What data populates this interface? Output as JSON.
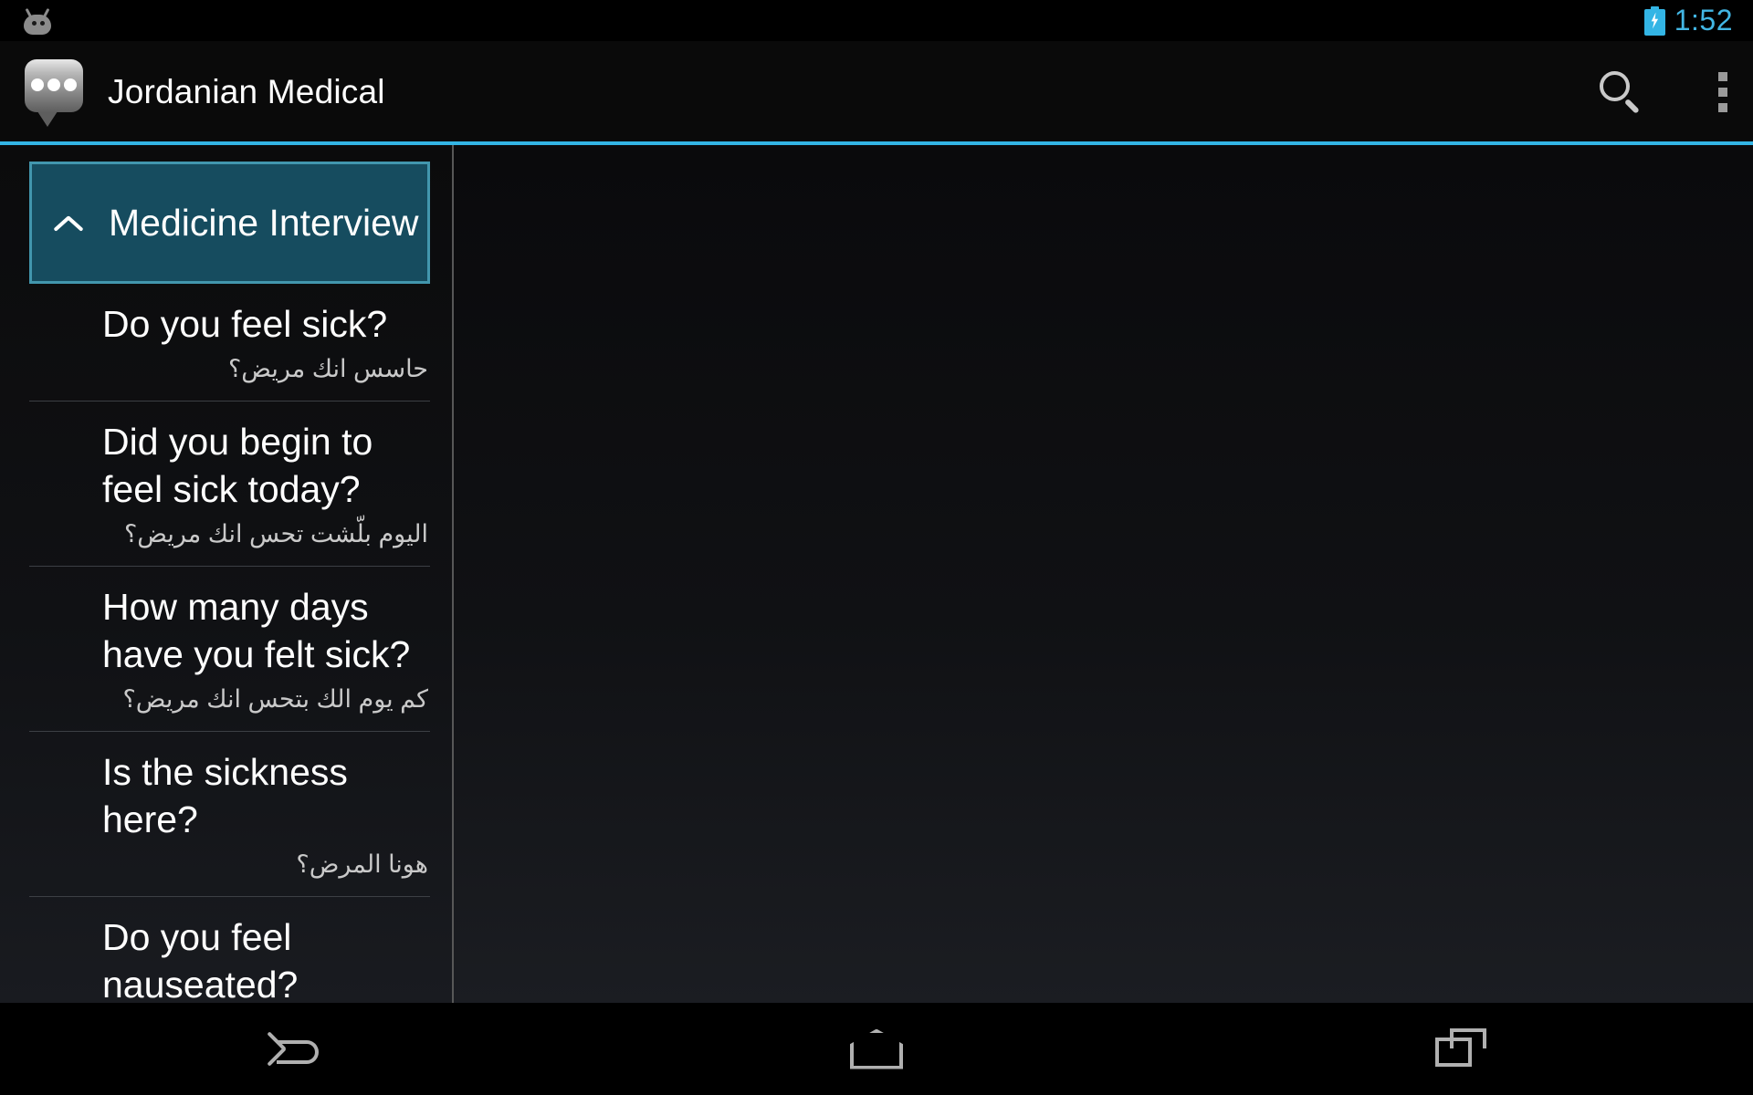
{
  "status_bar": {
    "droid_icon": "android-droid-icon",
    "battery_icon": "battery-charging-icon",
    "clock": "1:52",
    "clock_color": "#33b5e5"
  },
  "action_bar": {
    "app_icon": "speech-bubble-icon",
    "title": "Jordanian Medical",
    "search_icon": "search-icon",
    "overflow_icon": "overflow-menu-icon",
    "accent_color": "#33b5e5"
  },
  "list": {
    "group": {
      "label": "Medicine Interview",
      "expanded": true,
      "chevron_icon": "chevron-up-icon",
      "background": "#164c5f",
      "border": "#4296ad"
    },
    "phrases": [
      {
        "en": "Do you feel sick?",
        "ar": "حاسس انك مريض؟"
      },
      {
        "en": "Did you begin to feel sick today?",
        "ar": "اليوم بلّشت تحس انك مريض؟"
      },
      {
        "en": "How many days have you felt sick?",
        "ar": "كم يوم الك بتحس انك مريض؟"
      },
      {
        "en": "Is the sickness here?",
        "ar": "هونا المرض؟"
      },
      {
        "en": "Do you feel nauseated?",
        "ar": ""
      }
    ]
  },
  "nav_bar": {
    "back_icon": "back-icon",
    "home_icon": "home-icon",
    "recents_icon": "recents-icon"
  }
}
